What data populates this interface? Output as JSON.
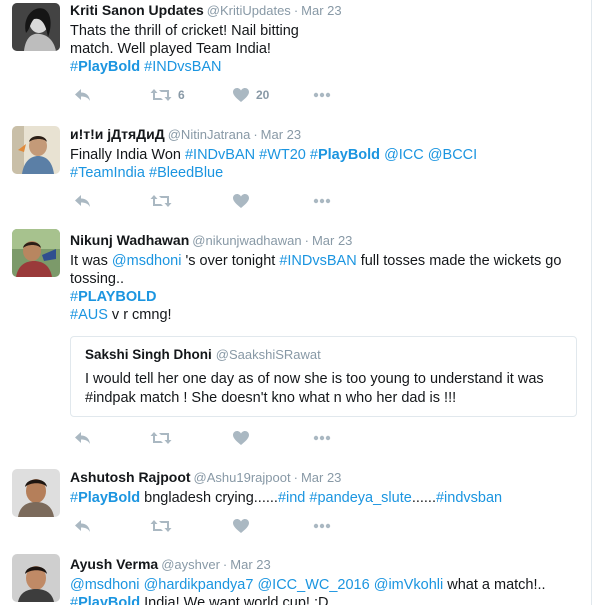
{
  "colors": {
    "link": "#1b95e0",
    "muted": "#8899a6",
    "text": "#14171a",
    "border": "#e1e8ed"
  },
  "icons": {
    "reply": "reply-icon",
    "retweet": "retweet-icon",
    "like": "heart-icon",
    "more": "more-icon"
  },
  "tweets": [
    {
      "name": "Kriti Sanon Updates",
      "handle": "@KritiUpdates",
      "sep": "·",
      "time": "Mar 23",
      "text": [
        {
          "t": "Thats the thrill of cricket! Nail bitting match. Well played Team India! "
        },
        {
          "t": "#",
          "c": "link"
        },
        {
          "t": "PlayBold",
          "c": "hashb"
        },
        {
          "t": " "
        },
        {
          "t": "#INDvsBAN",
          "c": "link"
        }
      ],
      "retweets": "6",
      "likes": "20"
    },
    {
      "name": "и!т!и јДтяДиД",
      "handle": "@NitinJatrana",
      "sep": "·",
      "time": "Mar 23",
      "text": [
        {
          "t": "Finally India Won "
        },
        {
          "t": "#INDvBAN",
          "c": "link"
        },
        {
          "t": " "
        },
        {
          "t": "#WT20",
          "c": "link"
        },
        {
          "t": " "
        },
        {
          "t": "#",
          "c": "link"
        },
        {
          "t": "PlayBold",
          "c": "hashb"
        },
        {
          "t": " "
        },
        {
          "t": "@ICC",
          "c": "link"
        },
        {
          "t": " "
        },
        {
          "t": "@BCCI",
          "c": "link"
        },
        {
          "t": " "
        },
        {
          "t": "#TeamIndia",
          "c": "link"
        },
        {
          "t": " "
        },
        {
          "t": "#BleedBlue",
          "c": "link"
        }
      ],
      "retweets": "",
      "likes": ""
    },
    {
      "name": "Nikunj Wadhawan",
      "handle": "@nikunjwadhawan",
      "sep": "·",
      "time": "Mar 23",
      "text": [
        {
          "t": "It was "
        },
        {
          "t": "@msdhoni",
          "c": "link"
        },
        {
          "t": " 's over tonight "
        },
        {
          "t": "#INDvsBAN",
          "c": "link"
        },
        {
          "t": " full tosses made the wickets go tossing.."
        },
        {
          "br": true
        },
        {
          "t": "#",
          "c": "link"
        },
        {
          "t": "PLAYBOLD",
          "c": "hashb"
        },
        {
          "br": true
        },
        {
          "t": "#AUS",
          "c": "link"
        },
        {
          "t": " v r cmng!"
        }
      ],
      "quote": {
        "name": "Sakshi Singh Dhoni",
        "handle": "@SaakshiSRawat",
        "text": "I would tell her one day as of now she is too young to understand it was #indpak match ! She doesn't kno what n who her dad is !!!"
      },
      "retweets": "",
      "likes": ""
    },
    {
      "name": "Ashutosh Rajpoot",
      "handle": "@Ashu19rajpoot",
      "sep": "·",
      "time": "Mar 23",
      "text": [
        {
          "t": "#",
          "c": "link"
        },
        {
          "t": "PlayBold",
          "c": "hashb"
        },
        {
          "t": " bngladesh crying......"
        },
        {
          "t": "#ind",
          "c": "link"
        },
        {
          "t": " "
        },
        {
          "t": "#pandeya_slute",
          "c": "link"
        },
        {
          "t": "......"
        },
        {
          "t": "#indvsban",
          "c": "link"
        }
      ],
      "retweets": "",
      "likes": ""
    },
    {
      "name": "Ayush Verma",
      "handle": "@ayshver",
      "sep": "·",
      "time": "Mar 23",
      "text": [
        {
          "t": "@msdhoni",
          "c": "link"
        },
        {
          "t": " "
        },
        {
          "t": "@hardikpandya7",
          "c": "link"
        },
        {
          "t": " "
        },
        {
          "t": "@ICC_WC_2016",
          "c": "link"
        },
        {
          "t": " "
        },
        {
          "t": "@imVkohli",
          "c": "link"
        },
        {
          "t": " what a match!.."
        },
        {
          "br": true
        },
        {
          "t": "#",
          "c": "link"
        },
        {
          "t": "PlayBold",
          "c": "hashb"
        },
        {
          "t": " India! We want world cup! :D"
        }
      ],
      "retweets": "",
      "likes": ""
    }
  ]
}
